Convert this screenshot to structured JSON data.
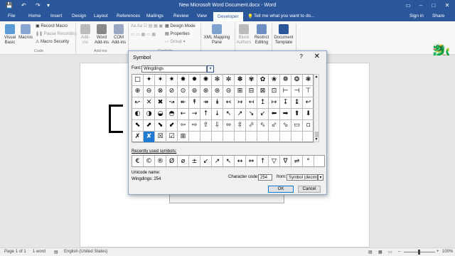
{
  "window": {
    "title": "New Microsoft Word Document.docx - Word",
    "quick_access": [
      "💾",
      "↶",
      "↷",
      "▾"
    ],
    "controls": [
      "▭",
      "–",
      "□",
      "✕"
    ]
  },
  "tabs": [
    "File",
    "Home",
    "Insert",
    "Design",
    "Layout",
    "References",
    "Mailings",
    "Review",
    "View",
    "Developer"
  ],
  "active_tab": "Developer",
  "tell_me": "Tell me what you want to do...",
  "sign_in": "Sign in",
  "share": "Share",
  "ribbon": {
    "visual_basic": "Visual Basic",
    "macros": "Macros",
    "record_macro": "Record Macro",
    "pause_recording": "Pause Recording",
    "macro_security": "Macro Security",
    "code_group": "Code",
    "add_ins": "Add-ins",
    "word_add_ins": "Word Add-ins",
    "com_add_ins": "COM Add-ins",
    "add_ins_group": "Add-ins",
    "design_mode": "Design Mode",
    "properties": "Properties",
    "group": "Group",
    "controls_group": "Controls",
    "xml_mapping": "XML Mapping Pane",
    "block_authors": "Block Authors",
    "restrict_editing": "Restrict Editing",
    "document_template": "Document Template"
  },
  "dialog": {
    "title": "Symbol",
    "help": "?",
    "close": "✕",
    "font_label": "Font:",
    "font_value": "Wingdings",
    "grid": [
      "□",
      "✦",
      "✶",
      "✷",
      "✸",
      "✹",
      "✺",
      "✻",
      "✼",
      "✽",
      "✾",
      "✿",
      "❀",
      "❁",
      "❂",
      "❃",
      "⊕",
      "⊖",
      "⊗",
      "⊘",
      "⊙",
      "⊚",
      "⊛",
      "⊜",
      "⊝",
      "⊞",
      "⊟",
      "⊠",
      "⊡",
      "⊢",
      "⊣",
      "⊤",
      "↜",
      "✕",
      "✖",
      "↝",
      "↞",
      "↟",
      "↠",
      "↡",
      "↢",
      "↣",
      "↤",
      "↥",
      "↦",
      "↧",
      "↨",
      "↩",
      "◐",
      "◑",
      "◒",
      "◓",
      "←",
      "→",
      "↑",
      "↓",
      "↖",
      "↗",
      "↘",
      "↙",
      "⬅",
      "➡",
      "⬆",
      "⬇",
      "⬉",
      "⬈",
      "⬊",
      "⬋",
      "⇦",
      "⇨",
      "⇧",
      "⇩",
      "⬄",
      "⇳",
      "⬀",
      "⬁",
      "⬃",
      "⬂",
      "▭",
      "▫",
      "✗",
      "✘",
      "☒",
      "☑",
      "⊞",
      "",
      "",
      "",
      "",
      "",
      "",
      "",
      "",
      "",
      "",
      ""
    ],
    "selected_index": 81,
    "recent_label": "Recently used symbols:",
    "recent": [
      "€",
      "©",
      "®",
      "Ø",
      "ø",
      "±",
      "↙",
      "↗",
      "↖",
      "↔",
      "⇔",
      "↑",
      "▽",
      "∇",
      "⇌",
      "°"
    ],
    "unicode_name_label": "Unicode name:",
    "unicode_name_value": "Wingdings: 254",
    "char_code_label": "Character code:",
    "char_code_value": "254",
    "from_label": "from:",
    "from_value": "Symbol (decimal)",
    "ok": "OK",
    "cancel": "Cancel"
  },
  "status": {
    "page": "Page 1 of 1",
    "words": "1 word",
    "language": "English (United States)",
    "zoom": "100%"
  },
  "colors": {
    "accent": "#2b579a",
    "selection": "#1f7bd1"
  }
}
